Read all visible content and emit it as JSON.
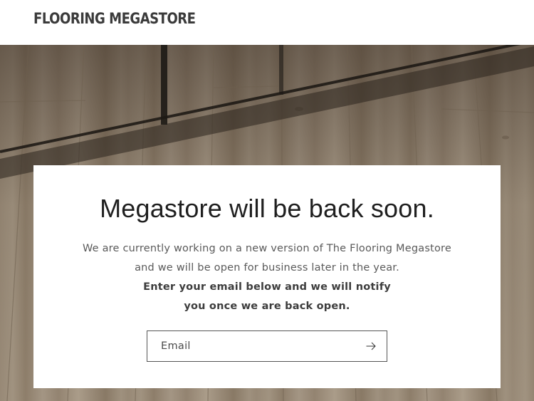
{
  "header": {
    "logo_text": "FLOORING MEGASTORE"
  },
  "card": {
    "title": "Megastore will be back soon.",
    "line1": "We are currently working on a new version of The Flooring Megastore",
    "line2": "and we will be open for business later in the year.",
    "line3": "Enter your email below and we will notify",
    "line4": "you once we are back open."
  },
  "signup": {
    "email_placeholder": "Email",
    "submit_icon": "arrow-right-icon"
  },
  "colors": {
    "text_dark": "#1f1f1f",
    "text_body": "#5a5a5a",
    "border": "#555555",
    "background": "#ffffff"
  }
}
